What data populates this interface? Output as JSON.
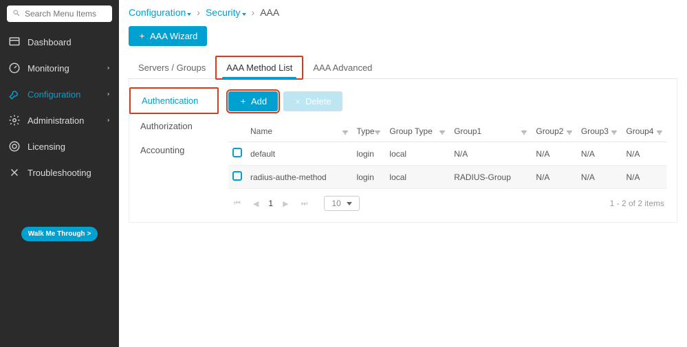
{
  "sidebar": {
    "search_placeholder": "Search Menu Items",
    "items": [
      {
        "label": "Dashboard",
        "icon": "dashboard",
        "expandable": false
      },
      {
        "label": "Monitoring",
        "icon": "gauge",
        "expandable": true
      },
      {
        "label": "Configuration",
        "icon": "wrench",
        "expandable": true,
        "active": true
      },
      {
        "label": "Administration",
        "icon": "gear",
        "expandable": true
      },
      {
        "label": "Licensing",
        "icon": "license",
        "expandable": false
      },
      {
        "label": "Troubleshooting",
        "icon": "tools",
        "expandable": false
      }
    ],
    "walk_label": "Walk Me Through >"
  },
  "breadcrumb": {
    "item1": "Configuration",
    "item2": "Security",
    "current": "AAA"
  },
  "wizard_button": "AAA Wizard",
  "tabs": {
    "t1": "Servers / Groups",
    "t2": "AAA Method List",
    "t3": "AAA Advanced"
  },
  "subtabs": {
    "s1": "Authentication",
    "s2": "Authorization",
    "s3": "Accounting"
  },
  "buttons": {
    "add": "Add",
    "delete": "Delete"
  },
  "table": {
    "headers": {
      "name": "Name",
      "type": "Type",
      "group_type": "Group Type",
      "group1": "Group1",
      "group2": "Group2",
      "group3": "Group3",
      "group4": "Group4"
    },
    "rows": [
      {
        "name": "default",
        "type": "login",
        "group_type": "local",
        "g1": "N/A",
        "g2": "N/A",
        "g3": "N/A",
        "g4": "N/A"
      },
      {
        "name": "radius-authe-method",
        "type": "login",
        "group_type": "local",
        "g1": "RADIUS-Group",
        "g2": "N/A",
        "g3": "N/A",
        "g4": "N/A"
      }
    ]
  },
  "pager": {
    "page": "1",
    "page_size": "10",
    "summary": "1 - 2 of 2 items"
  }
}
